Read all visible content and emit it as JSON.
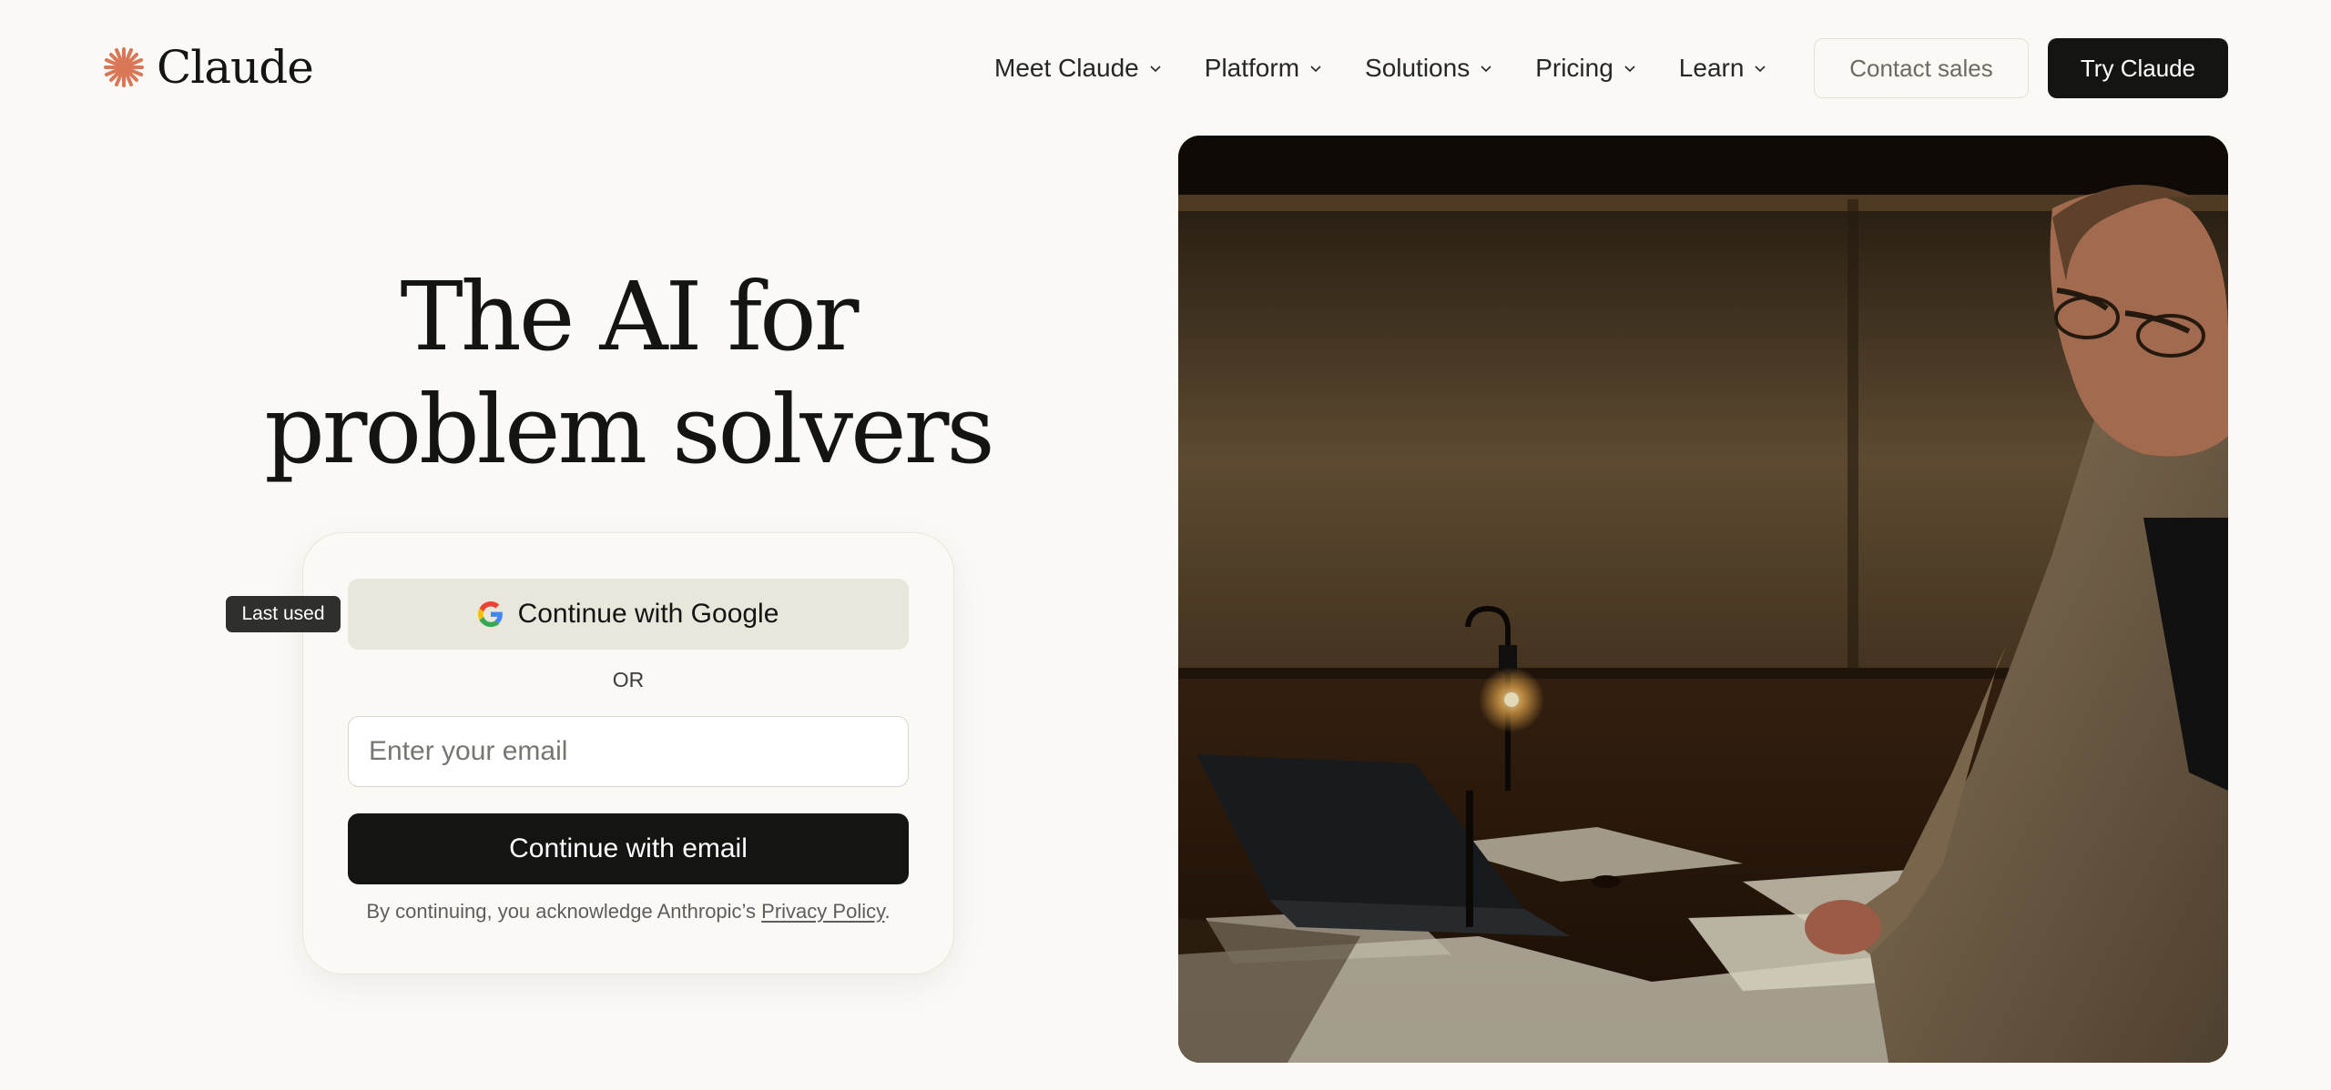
{
  "brand": {
    "name": "Claude",
    "accent": "#d97757"
  },
  "nav": {
    "items": [
      {
        "label": "Meet Claude"
      },
      {
        "label": "Platform"
      },
      {
        "label": "Solutions"
      },
      {
        "label": "Pricing"
      },
      {
        "label": "Learn"
      }
    ],
    "contact_label": "Contact sales",
    "try_label": "Try Claude"
  },
  "hero": {
    "title_line1": "The AI for",
    "title_line2": "problem solvers"
  },
  "auth": {
    "last_used_badge": "Last used",
    "google_label": "Continue with Google",
    "or_label": "OR",
    "email_placeholder": "Enter your email",
    "email_value": "",
    "email_button_label": "Continue with email",
    "legal_prefix": "By continuing, you acknowledge Anthropic’s",
    "legal_link": "Privacy Policy",
    "legal_suffix": "."
  },
  "icons": {
    "logo": "claude-spark-icon",
    "chevron": "chevron-down-icon",
    "google": "google-g-icon"
  },
  "colors": {
    "background": "#faf9f5",
    "primary_button": "#141413",
    "google_button": "#e9e6dc"
  }
}
